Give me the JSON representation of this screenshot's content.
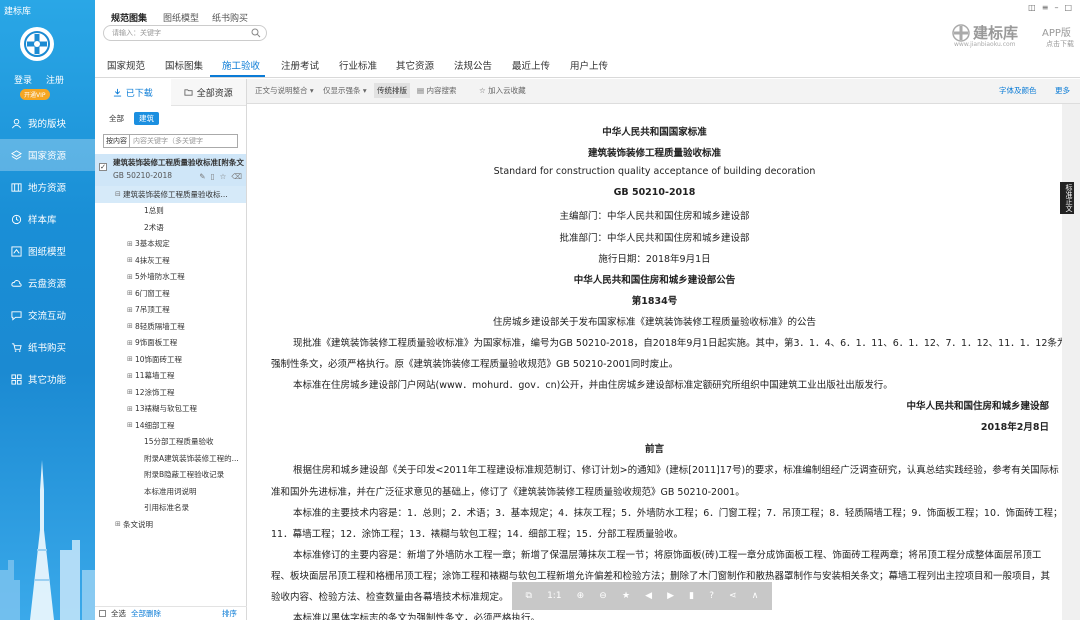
{
  "sidebar": {
    "app_title": "建标库",
    "login": "登录",
    "register": "注册",
    "vip": "开通VIP",
    "items": [
      {
        "label": "我的版块",
        "icon": "user-icon"
      },
      {
        "label": "国家资源",
        "icon": "layers-icon",
        "active": true
      },
      {
        "label": "地方资源",
        "icon": "map-icon"
      },
      {
        "label": "样本库",
        "icon": "refresh-icon"
      },
      {
        "label": "图纸模型",
        "icon": "drawing-icon"
      },
      {
        "label": "云盘资源",
        "icon": "cloud-icon"
      },
      {
        "label": "交流互动",
        "icon": "chat-icon"
      },
      {
        "label": "纸书购买",
        "icon": "cart-icon"
      },
      {
        "label": "其它功能",
        "icon": "grid-icon"
      }
    ]
  },
  "topbar": {
    "tabs": [
      "规范图集",
      "图纸模型",
      "纸书购买"
    ],
    "search_placeholder": "请输入：关键字",
    "brand_name": "建标库",
    "brand_url": "www.jianbiaoku.com",
    "app_line1": "APP版",
    "app_line2": "点击下载"
  },
  "categories": [
    "国家规范",
    "国标图集",
    "施工验收",
    "注册考试",
    "行业标准",
    "其它资源",
    "法规公告",
    "最近上传",
    "用户上传"
  ],
  "left": {
    "tab_downloaded": "已下载",
    "tab_all": "全部资源",
    "filter_all": "全部",
    "filter_build": "建筑",
    "search_select": "按内容",
    "search_placeholder": "内容关键字（多关键字",
    "doc_title": "建筑装饰装修工程质量验收标准[附条文",
    "doc_code": "GB 50210-2018",
    "tree": [
      {
        "label": "建筑装饰装修工程质量验收标...",
        "level": 0,
        "pm": "⊟",
        "sel": true
      },
      {
        "label": "1总则",
        "level": 2,
        "pm": ""
      },
      {
        "label": "2术语",
        "level": 2,
        "pm": ""
      },
      {
        "label": "3基本规定",
        "level": 1,
        "pm": "⊞"
      },
      {
        "label": "4抹灰工程",
        "level": 1,
        "pm": "⊞"
      },
      {
        "label": "5外墙防水工程",
        "level": 1,
        "pm": "⊞"
      },
      {
        "label": "6门窗工程",
        "level": 1,
        "pm": "⊞"
      },
      {
        "label": "7吊顶工程",
        "level": 1,
        "pm": "⊞"
      },
      {
        "label": "8轻质隔墙工程",
        "level": 1,
        "pm": "⊞"
      },
      {
        "label": "9饰面板工程",
        "level": 1,
        "pm": "⊞"
      },
      {
        "label": "10饰面砖工程",
        "level": 1,
        "pm": "⊞"
      },
      {
        "label": "11幕墙工程",
        "level": 1,
        "pm": "⊞"
      },
      {
        "label": "12涂饰工程",
        "level": 1,
        "pm": "⊞"
      },
      {
        "label": "13裱糊与软包工程",
        "level": 1,
        "pm": "⊞"
      },
      {
        "label": "14细部工程",
        "level": 1,
        "pm": "⊞"
      },
      {
        "label": "15分部工程质量验收",
        "level": 2,
        "pm": ""
      },
      {
        "label": "附录A建筑装饰装修工程的...",
        "level": 2,
        "pm": ""
      },
      {
        "label": "附录B隐蔽工程验收记录",
        "level": 2,
        "pm": ""
      },
      {
        "label": "本标准用词说明",
        "level": 2,
        "pm": ""
      },
      {
        "label": "引用标准名录",
        "level": 2,
        "pm": ""
      },
      {
        "label": "条文说明",
        "level": 0,
        "pm": "⊞"
      }
    ],
    "footer_check": "全选",
    "footer_delete": "全部删除",
    "footer_sort": "排序"
  },
  "toolbar": {
    "mode": "正文与说明整合",
    "show": "仅显示强条",
    "layout": "传统排版",
    "search": "内容搜索",
    "cloud": "加入云收藏",
    "font": "字体及颜色",
    "more": "更多"
  },
  "doc": {
    "l1": "中华人民共和国国家标准",
    "l2": "建筑装饰装修工程质量验收标准",
    "l3": "Standard  for  construction  quality  acceptance  of  building  decoration",
    "l4": "GB  50210-2018",
    "l5": "主编部门：中华人民共和国住房和城乡建设部",
    "l6": "批准部门：中华人民共和国住房和城乡建设部",
    "l7": "施行日期：2018年9月1日",
    "l8": "中华人民共和国住房和城乡建设部公告",
    "l9": "第1834号",
    "l10": "住房城乡建设部关于发布国家标准《建筑装饰装修工程质量验收标准》的公告",
    "l11": "现批准《建筑装饰装修工程质量验收标准》为国家标准，编号为GB  50210-2018，自2018年9月1日起实施。其中，第3．1．4、6．1．11、6．1．12、7．1．12、11．1．12条为",
    "l12": "强制性条文，必须严格执行。原《建筑装饰装修工程质量验收规范》GB  50210-2001同时废止。",
    "l13": "本标准在住房城乡建设部门户网站(www．mohurd．gov．cn)公开，并由住房城乡建设部标准定额研究所组织中国建筑工业出版社出版发行。",
    "l14": "中华人民共和国住房和城乡建设部",
    "l15": "2018年2月8日",
    "l16": "前言",
    "l17": "根据住房和城乡建设部《关于印发<2011年工程建设标准规范制订、修订计划>的通知》(建标[2011]17号)的要求，标准编制组经广泛调查研究，认真总结实践经验，参考有关国际标",
    "l18": "准和国外先进标准，并在广泛征求意见的基础上，修订了《建筑装饰装修工程质量验收规范》GB  50210-2001。",
    "l19": "本标准的主要技术内容是：1．总则；2．术语；3．基本规定；4．抹灰工程；5．外墙防水工程；6．门窗工程；7．吊顶工程；8．轻质隔墙工程；9．饰面板工程；10．饰面砖工程；",
    "l20": "11．幕墙工程；12．涂饰工程；13．裱糊与软包工程；14．细部工程；15．分部工程质量验收。",
    "l21": "本标准修订的主要内容是：新增了外墙防水工程一章；新增了保温层薄抹灰工程一节；将原饰面板(砖)工程一章分成饰面板工程、饰面砖工程两章；将吊顶工程分成整体面层吊顶工",
    "l22": "程、板块面层吊顶工程和格栅吊顶工程；涂饰工程和裱糊与软包工程新增允许偏差和检验方法；删除了木门窗制作和散热器罩制作与安装相关条文；幕墙工程列出主控项目和一般项目，其",
    "l23": "验收内容、检验方法、检查数量由各幕墙技术标准规定。",
    "l24": "本标准以黑体字标志的条文为强制性条文，必须严格执行。",
    "side_tag": "标准正文"
  },
  "viewer": {
    "fit": "1:1"
  },
  "colors": {
    "accent": "#0a7bd6",
    "sidebar": "#1b8ad2",
    "vip": "#f5a623"
  }
}
